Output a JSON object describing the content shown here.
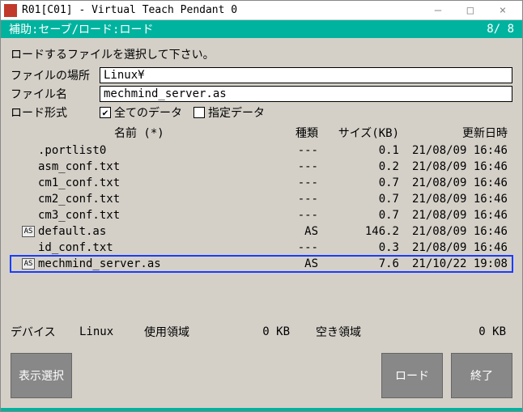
{
  "titlebar": {
    "text": "R01[C01] - Virtual Teach Pendant 0",
    "min": "—",
    "max": "□",
    "close": "×"
  },
  "subheader": {
    "left": "補助:セーブ/ロード:ロード",
    "right": "8/ 8"
  },
  "prompt": "ロードするファイルを選択して下さい。",
  "labels": {
    "location": "ファイルの場所",
    "filename": "ファイル名",
    "format": "ロード形式"
  },
  "inputs": {
    "location": "Linux¥",
    "filename": "mechmind_server.as"
  },
  "checks": {
    "all_checked": "✔",
    "all_label": "全てのデータ",
    "spec_checked": "",
    "spec_label": "指定データ"
  },
  "columns": {
    "name": "名前   (*)",
    "kind": "種類",
    "size": "サイズ(KB)",
    "date": "更新日時"
  },
  "files": [
    {
      "icon": "",
      "name": ".portlist0",
      "kind": "---",
      "size": "0.1",
      "date": "21/08/09 16:46",
      "sel": false
    },
    {
      "icon": "",
      "name": "asm_conf.txt",
      "kind": "---",
      "size": "0.2",
      "date": "21/08/09 16:46",
      "sel": false
    },
    {
      "icon": "",
      "name": "cm1_conf.txt",
      "kind": "---",
      "size": "0.7",
      "date": "21/08/09 16:46",
      "sel": false
    },
    {
      "icon": "",
      "name": "cm2_conf.txt",
      "kind": "---",
      "size": "0.7",
      "date": "21/08/09 16:46",
      "sel": false
    },
    {
      "icon": "",
      "name": "cm3_conf.txt",
      "kind": "---",
      "size": "0.7",
      "date": "21/08/09 16:46",
      "sel": false
    },
    {
      "icon": "AS",
      "name": "default.as",
      "kind": "AS",
      "size": "146.2",
      "date": "21/08/09 16:46",
      "sel": false
    },
    {
      "icon": "",
      "name": "id_conf.txt",
      "kind": "---",
      "size": "0.3",
      "date": "21/08/09 16:46",
      "sel": false
    },
    {
      "icon": "AS",
      "name": "mechmind_server.as",
      "kind": "AS",
      "size": "7.6",
      "date": "21/10/22 19:08",
      "sel": true
    }
  ],
  "device": {
    "label": "デバイス",
    "name": "Linux",
    "used_label": "使用領域",
    "used_value": "0 KB",
    "free_label": "空き領域",
    "free_value": "0 KB"
  },
  "buttons": {
    "display_select": "表示選択",
    "load": "ロード",
    "exit": "終了"
  }
}
